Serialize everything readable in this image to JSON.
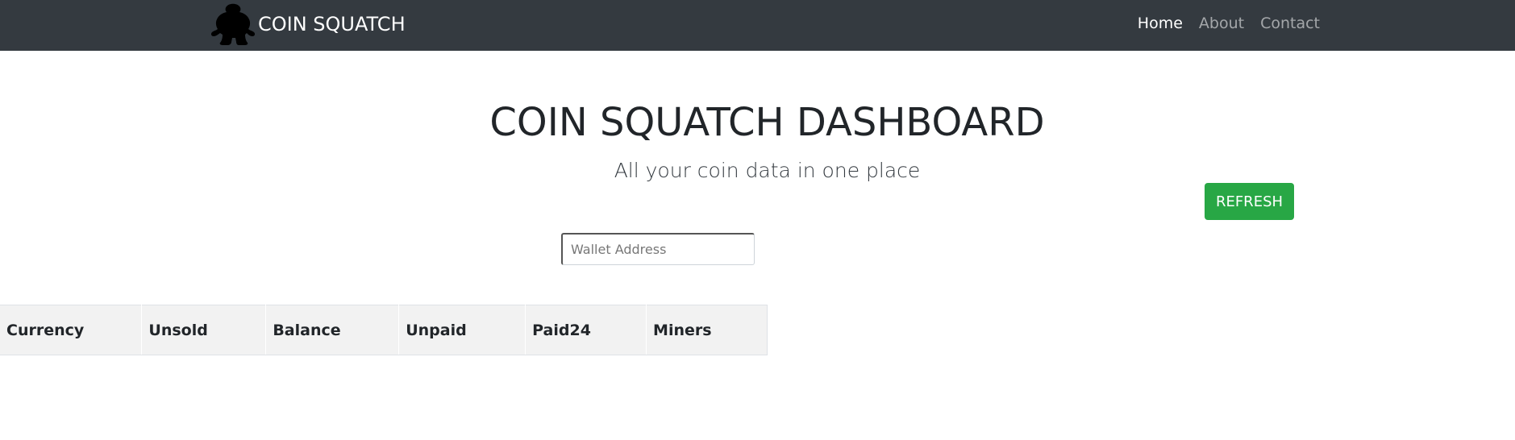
{
  "navbar": {
    "brand_text": "COIN SQUATCH",
    "logo_icon": "bigfoot-logo-icon",
    "links": [
      {
        "label": "Home",
        "active": true
      },
      {
        "label": "About",
        "active": false
      },
      {
        "label": "Contact",
        "active": false
      }
    ]
  },
  "header": {
    "title": "COIN SQUATCH DASHBOARD",
    "subtitle": "All your coin data in one place"
  },
  "actions": {
    "refresh_label": "REFRESH"
  },
  "wallet": {
    "placeholder": "Wallet Address",
    "value": ""
  },
  "table": {
    "columns": [
      "Currency",
      "Unsold",
      "Balance",
      "Unpaid",
      "Paid24",
      "Miners"
    ],
    "rows": []
  },
  "colors": {
    "navbar_bg": "#343a40",
    "refresh_bg": "#28a745",
    "table_header_bg": "#f2f2f2"
  }
}
